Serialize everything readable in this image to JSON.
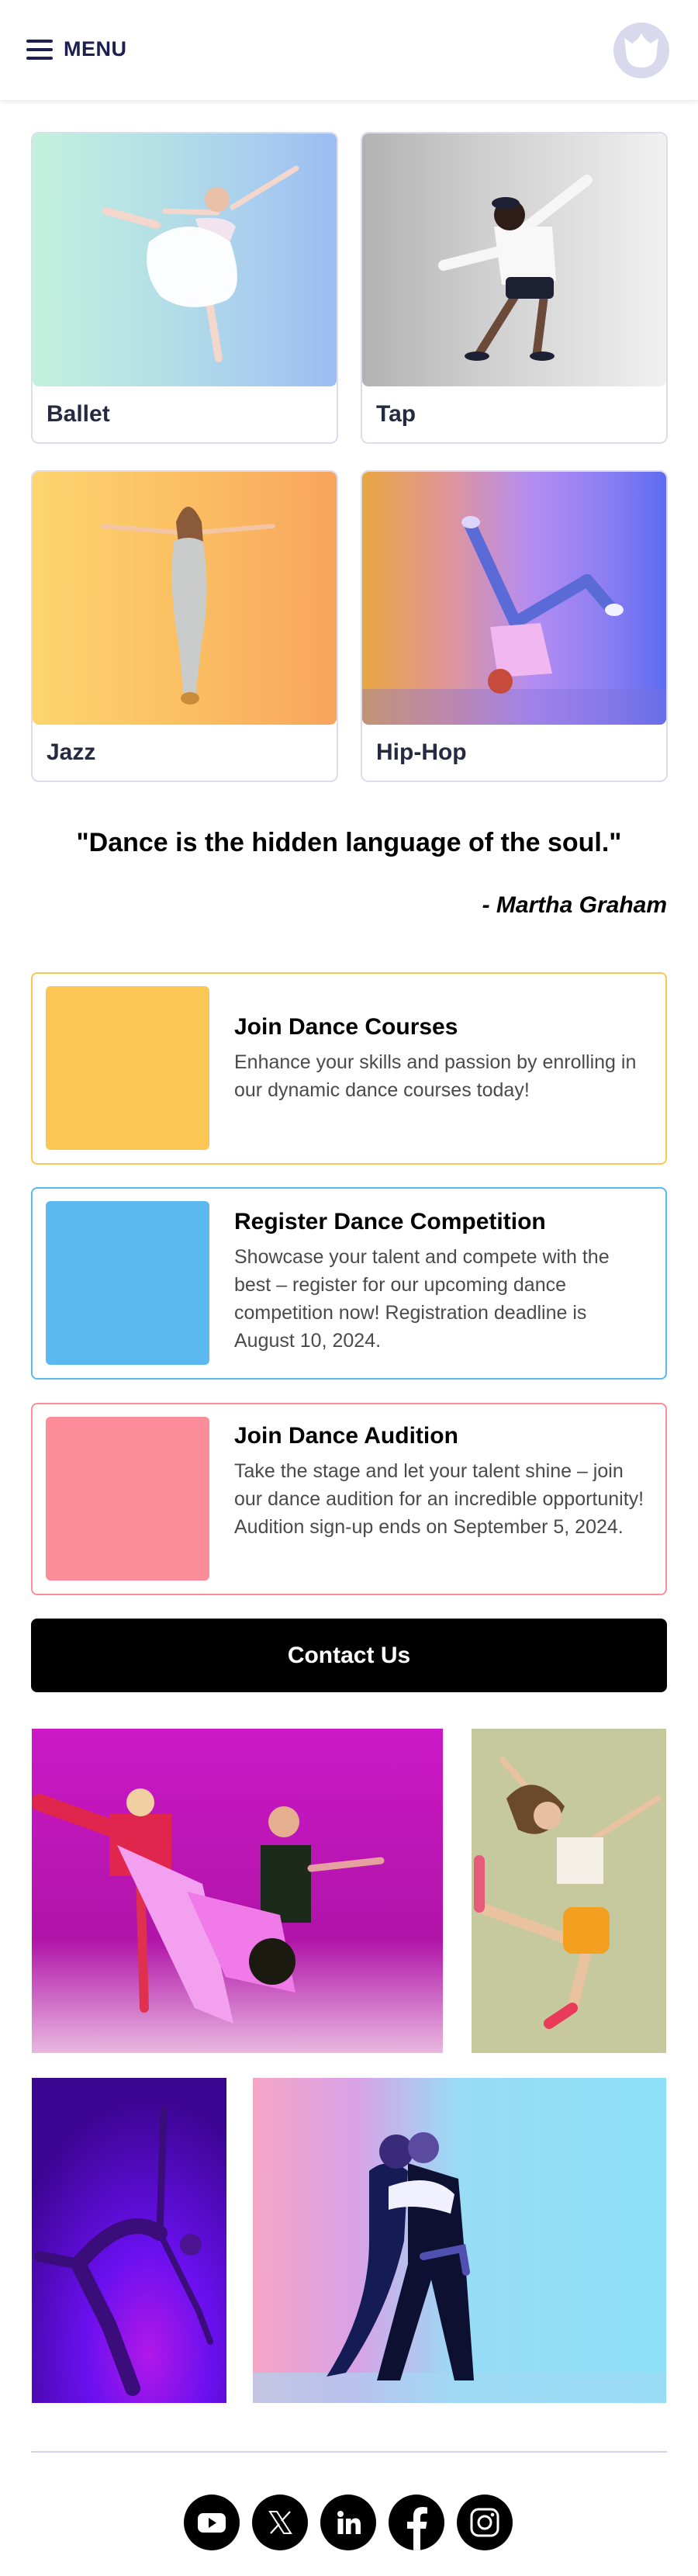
{
  "header": {
    "menu_label": "MENU",
    "menu_icon": "hamburger-icon",
    "logo_icon": "cat-logo-icon"
  },
  "categories": [
    {
      "label": "Ballet",
      "image": "ballet-dancer-photo"
    },
    {
      "label": "Tap",
      "image": "tap-dancer-photo"
    },
    {
      "label": "Jazz",
      "image": "jazz-dancer-photo"
    },
    {
      "label": "Hip-Hop",
      "image": "hiphop-dancer-photo"
    }
  ],
  "quote": {
    "text": "\"Dance is the hidden language of the soul.\"",
    "author": "- Martha Graham"
  },
  "info_cards": [
    {
      "title": "Join Dance Courses",
      "description": "Enhance your skills and passion by enrolling in our dynamic dance courses today!",
      "color": "#fbc653"
    },
    {
      "title": "Register Dance Competition",
      "description": "Showcase your talent and compete with the best – register for our upcoming dance competition now! Registration deadline is August 10, 2024.",
      "color": "#5bb9ef"
    },
    {
      "title": "Join Dance Audition",
      "description": "Take the stage and let your talent shine – join our dance audition for an incredible opportunity! Audition sign-up ends on September 5, 2024.",
      "color": "#fd8d98"
    }
  ],
  "contact_button": {
    "label": "Contact Us"
  },
  "gallery": [
    {
      "image": "group-dancers-magenta-photo"
    },
    {
      "image": "jumping-dancer-photo"
    },
    {
      "image": "contemporary-dancer-purple-photo"
    },
    {
      "image": "tango-couple-photo"
    }
  ],
  "socials": [
    {
      "name": "youtube"
    },
    {
      "name": "x"
    },
    {
      "name": "linkedin"
    },
    {
      "name": "facebook"
    },
    {
      "name": "instagram"
    }
  ]
}
